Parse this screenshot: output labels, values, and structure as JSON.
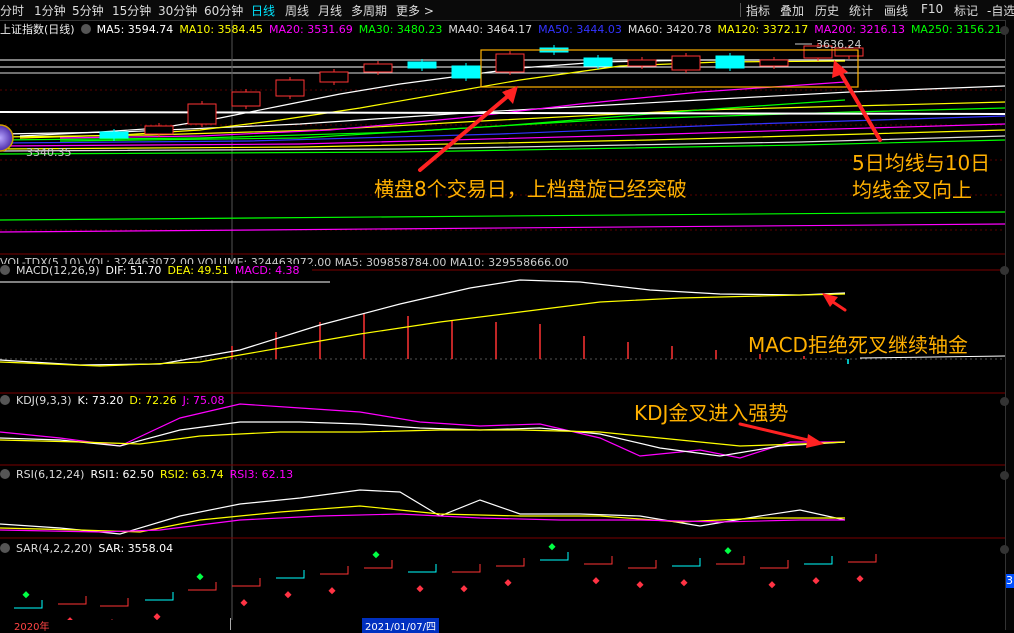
{
  "toolbar": {
    "periods": [
      "分时",
      "1分钟",
      "5分钟",
      "15分钟",
      "30分钟",
      "60分钟",
      "日线",
      "周线",
      "月线",
      "多周期",
      "更多"
    ],
    "active_period": "日线",
    "more_arrow": ">",
    "tools": [
      "指标",
      "叠加",
      "历史",
      "统计",
      "画线",
      "F10",
      "标记",
      "-自选"
    ]
  },
  "main_pane": {
    "title": "上证指数(日线)",
    "ma": [
      {
        "label": "MA5: 3594.74",
        "color": "#ffffff"
      },
      {
        "label": "MA10: 3584.45",
        "color": "#ffff00"
      },
      {
        "label": "MA20: 3531.69",
        "color": "#ff00ff"
      },
      {
        "label": "MA30: 3480.23",
        "color": "#00ff00"
      },
      {
        "label": "MA40: 3464.17",
        "color": "#dddddd"
      },
      {
        "label": "MA50: 3444.03",
        "color": "#3333ff"
      },
      {
        "label": "MA60: 3420.78",
        "color": "#dddddd"
      },
      {
        "label": "MA120: 3372.17",
        "color": "#ffff00"
      },
      {
        "label": "MA200: 3216.13",
        "color": "#ff00ff"
      },
      {
        "label": "MA250: 3156.21",
        "color": "#00ff00"
      }
    ],
    "high_label": "3636.24",
    "low_label": "3340.35"
  },
  "vol_pane": {
    "label": "VOL-TDX(5,10) VOL: 324463072.00 VOLUME: 324463072.00 MA5: 309858784.00 MA10: 329558666.00"
  },
  "macd_pane": {
    "items": [
      {
        "label": "MACD(12,26,9)",
        "color": "#dddddd"
      },
      {
        "label": "DIF: 51.70",
        "color": "#ffffff"
      },
      {
        "label": "DEA: 49.51",
        "color": "#ffff00"
      },
      {
        "label": "MACD: 4.38",
        "color": "#ff00ff"
      }
    ]
  },
  "kdj_pane": {
    "items": [
      {
        "label": "KDJ(9,3,3)",
        "color": "#dddddd"
      },
      {
        "label": "K: 73.20",
        "color": "#ffffff"
      },
      {
        "label": "D: 72.26",
        "color": "#ffff00"
      },
      {
        "label": "J: 75.08",
        "color": "#ff00ff"
      }
    ]
  },
  "rsi_pane": {
    "items": [
      {
        "label": "RSI(6,12,24)",
        "color": "#dddddd"
      },
      {
        "label": "RSI1: 62.50",
        "color": "#ffffff"
      },
      {
        "label": "RSI2: 63.74",
        "color": "#ffff00"
      },
      {
        "label": "RSI3: 62.13",
        "color": "#ff00ff"
      }
    ]
  },
  "sar_pane": {
    "items": [
      {
        "label": "SAR(4,2,2,20)",
        "color": "#dddddd"
      },
      {
        "label": "SAR: 3558.04",
        "color": "#ffffff"
      }
    ]
  },
  "annotations": {
    "sideways": "横盘8个交易日，上档盘旋已经突破",
    "golden_cross_1": "5日均线与10日",
    "golden_cross_2": "均线金叉向上",
    "macd": "MACD拒绝死叉继续轴金",
    "kdj": "KDJ金叉进入强势"
  },
  "date_axis": {
    "year": "2020年",
    "cursor_date": "2021/01/07/四",
    "right_tag": "3"
  },
  "colors": {
    "up": "#ff3333",
    "down": "#00ffff",
    "accent": "#ffb000",
    "grid": "#7a0000"
  }
}
